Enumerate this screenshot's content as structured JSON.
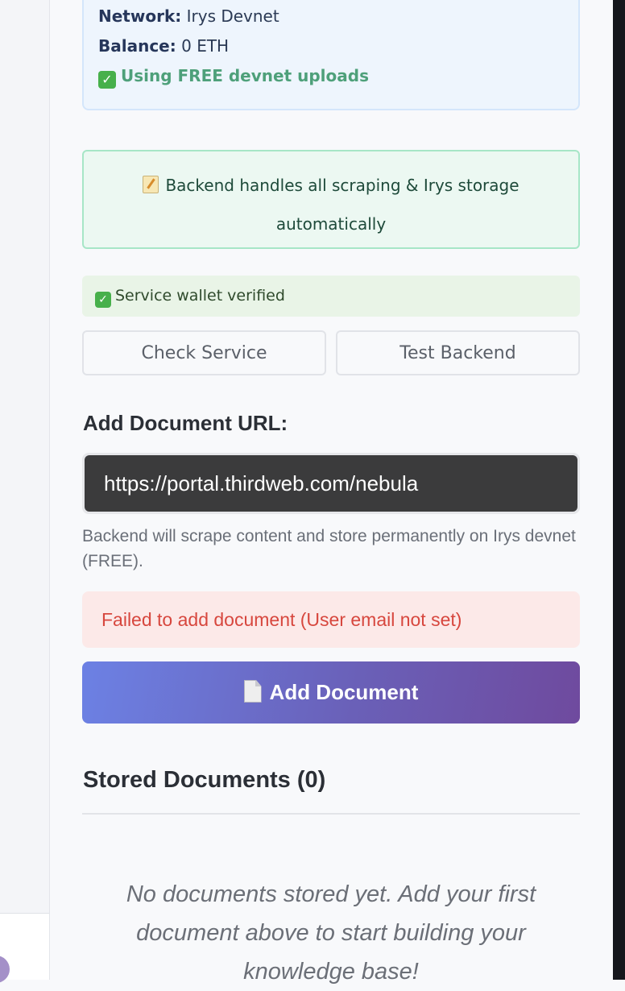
{
  "wallet": {
    "network_label": "Network:",
    "network_value": "Irys Devnet",
    "balance_label": "Balance:",
    "balance_value": "0 ETH",
    "free_text": "Using FREE devnet uploads"
  },
  "backend_notice": {
    "text": "Backend handles all scraping & Irys storage automatically"
  },
  "service_status": {
    "text": "Service wallet verified"
  },
  "buttons": {
    "check_service": "Check Service",
    "test_backend": "Test Backend",
    "add_document": "Add Document"
  },
  "add_document": {
    "label": "Add Document URL:",
    "url_value": "https://portal.thirdweb.com/nebula",
    "hint": "Backend will scrape content and store permanently on Irys devnet (FREE).",
    "error": "Failed to add document (User email not set)"
  },
  "stored": {
    "title": "Stored Documents (0)",
    "empty_message": "No documents stored yet. Add your first document above to start building your knowledge base!"
  },
  "icons": {
    "check": "check-mark-icon",
    "memo": "memo-icon",
    "document": "document-icon"
  },
  "colors": {
    "accent_gradient_start": "#6c81e4",
    "accent_gradient_end": "#6f4a9e",
    "success": "#4ea07a",
    "error": "#d7473e"
  }
}
